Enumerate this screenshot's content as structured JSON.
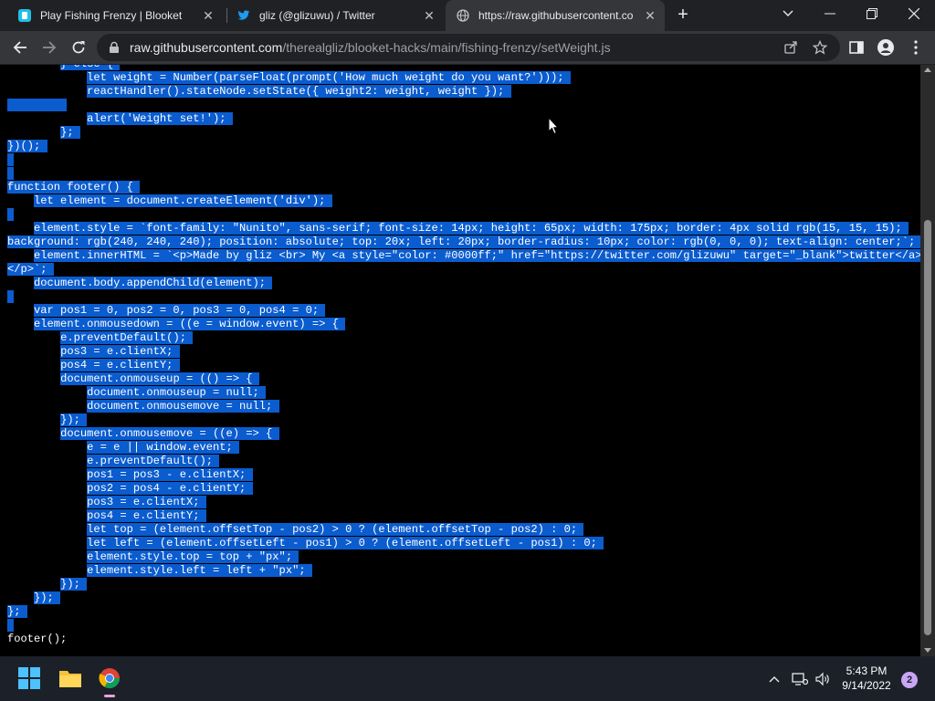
{
  "browser": {
    "tabs": [
      {
        "title": "Play Fishing Frenzy | Blooket",
        "icon": "blooket-icon",
        "active": false
      },
      {
        "title": "gliz (@glizuwu) / Twitter",
        "icon": "twitter-icon",
        "active": false
      },
      {
        "title": "https://raw.githubusercontent.co",
        "icon": "globe-icon",
        "active": true
      }
    ],
    "url_host": "raw.githubusercontent.com",
    "url_path": "/therealgliz/blooket-hacks/main/fishing-frenzy/setWeight.js"
  },
  "code_lines": [
    {
      "text": "        } else {",
      "sel": "        } else {"
    },
    {
      "text": "            let weight = Number(parseFloat(prompt('How much weight do you want?')));",
      "sel": "            let weight = Number(parseFloat(prompt('How much weight do you want?')));"
    },
    {
      "text": "            reactHandler().stateNode.setState({ weight2: weight, weight });",
      "sel": "            reactHandler().stateNode.setState({ weight2: weight, weight });"
    },
    {
      "text": "",
      "sel": "         "
    },
    {
      "text": "            alert('Weight set!');",
      "sel": "            alert('Weight set!');"
    },
    {
      "text": "        };",
      "sel": "        };"
    },
    {
      "text": "})();",
      "sel": "})();"
    },
    {
      "text": "",
      "sel": " "
    },
    {
      "text": "",
      "sel": " "
    },
    {
      "text": "function footer() {",
      "sel": "function footer() {"
    },
    {
      "text": "    let element = document.createElement('div');",
      "sel": "    let element = document.createElement('div');"
    },
    {
      "text": "",
      "sel": " "
    },
    {
      "text": "    element.style = `font-family: \"Nunito\", sans-serif; font-size: 14px; height: 65px; width: 175px; border: 4px solid rgb(15, 15, 15);",
      "sel": "    element.style = `font-family: \"Nunito\", sans-serif; font-size: 14px; height: 65px; width: 175px; border: 4px solid rgb(15, 15, 15);"
    },
    {
      "text": "background: rgb(240, 240, 240); position: absolute; top: 20x; left: 20px; border-radius: 10px; color: rgb(0, 0, 0); text-align: center;`;",
      "sel": "background: rgb(240, 240, 240); position: absolute; top: 20x; left: 20px; border-radius: 10px; color: rgb(0, 0, 0); text-align: center;`;"
    },
    {
      "text": "    element.innerHTML = `<p>Made by gliz <br> My <a style=\"color: #0000ff;\" href=\"https://twitter.com/glizuwu\" target=\"_blank\">twitter</a>",
      "sel": "    element.innerHTML = `<p>Made by gliz <br> My <a style=\"color: #0000ff;\" href=\"https://twitter.com/glizuwu\" target=\"_blank\">twitter</a>"
    },
    {
      "text": "</p>`;",
      "sel": "</p>`;"
    },
    {
      "text": "    document.body.appendChild(element);",
      "sel": "    document.body.appendChild(element);"
    },
    {
      "text": "",
      "sel": " "
    },
    {
      "text": "    var pos1 = 0, pos2 = 0, pos3 = 0, pos4 = 0;",
      "sel": "    var pos1 = 0, pos2 = 0, pos3 = 0, pos4 = 0;"
    },
    {
      "text": "    element.onmousedown = ((e = window.event) => {",
      "sel": "    element.onmousedown = ((e = window.event) => {"
    },
    {
      "text": "        e.preventDefault();",
      "sel": "        e.preventDefault();"
    },
    {
      "text": "        pos3 = e.clientX;",
      "sel": "        pos3 = e.clientX;"
    },
    {
      "text": "        pos4 = e.clientY;",
      "sel": "        pos4 = e.clientY;"
    },
    {
      "text": "        document.onmouseup = (() => {",
      "sel": "        document.onmouseup = (() => {"
    },
    {
      "text": "            document.onmouseup = null;",
      "sel": "            document.onmouseup = null;"
    },
    {
      "text": "            document.onmousemove = null;",
      "sel": "            document.onmousemove = null;"
    },
    {
      "text": "        });",
      "sel": "        });"
    },
    {
      "text": "        document.onmousemove = ((e) => {",
      "sel": "        document.onmousemove = ((e) => {"
    },
    {
      "text": "            e = e || window.event;",
      "sel": "            e = e || window.event;"
    },
    {
      "text": "            e.preventDefault();",
      "sel": "            e.preventDefault();"
    },
    {
      "text": "            pos1 = pos3 - e.clientX;",
      "sel": "            pos1 = pos3 - e.clientX;"
    },
    {
      "text": "            pos2 = pos4 - e.clientY;",
      "sel": "            pos2 = pos4 - e.clientY;"
    },
    {
      "text": "            pos3 = e.clientX;",
      "sel": "            pos3 = e.clientX;"
    },
    {
      "text": "            pos4 = e.clientY;",
      "sel": "            pos4 = e.clientY;"
    },
    {
      "text": "            let top = (element.offsetTop - pos2) > 0 ? (element.offsetTop - pos2) : 0;",
      "sel": "            let top = (element.offsetTop - pos2) > 0 ? (element.offsetTop - pos2) : 0;"
    },
    {
      "text": "            let left = (element.offsetLeft - pos1) > 0 ? (element.offsetLeft - pos1) : 0;",
      "sel": "            let left = (element.offsetLeft - pos1) > 0 ? (element.offsetLeft - pos1) : 0;"
    },
    {
      "text": "            element.style.top = top + \"px\";",
      "sel": "            element.style.top = top + \"px\";"
    },
    {
      "text": "            element.style.left = left + \"px\";",
      "sel": "            element.style.left = left + \"px\";"
    },
    {
      "text": "        });",
      "sel": "        });"
    },
    {
      "text": "    });",
      "sel": "    });"
    },
    {
      "text": "};",
      "sel": "};"
    },
    {
      "text": "",
      "sel": " "
    },
    {
      "text": "footer();",
      "sel": ""
    }
  ],
  "taskbar": {
    "apps": [
      "windows-start-icon",
      "file-explorer-icon",
      "chrome-icon"
    ],
    "time": "5:43 PM",
    "date": "9/14/2022",
    "notification_count": "2"
  }
}
